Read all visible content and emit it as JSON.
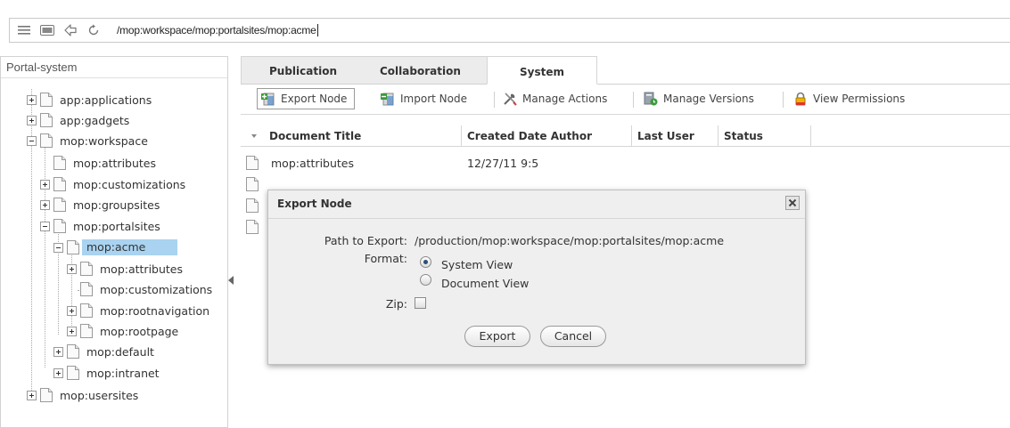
{
  "address_bar": {
    "path": "/mop:workspace/mop:portalsites/mop:acme",
    "icons": [
      "menu-icon",
      "window-icon",
      "back-icon",
      "refresh-icon"
    ]
  },
  "left_panel": {
    "title": "Portal-system",
    "tree": [
      {
        "label": "app:applications",
        "expand": "plus"
      },
      {
        "label": "app:gadgets",
        "expand": "plus"
      },
      {
        "label": "mop:workspace",
        "expand": "minus"
      },
      {
        "label": "mop:attributes",
        "expand": "none"
      },
      {
        "label": "mop:customizations",
        "expand": "plus"
      },
      {
        "label": "mop:groupsites",
        "expand": "plus"
      },
      {
        "label": "mop:portalsites",
        "expand": "minus"
      },
      {
        "label": "mop:acme",
        "expand": "minus",
        "selected": true
      },
      {
        "label": "mop:attributes",
        "expand": "plus"
      },
      {
        "label": "mop:customizations",
        "expand": "none"
      },
      {
        "label": "mop:rootnavigation",
        "expand": "plus"
      },
      {
        "label": "mop:rootpage",
        "expand": "plus"
      },
      {
        "label": "mop:default",
        "expand": "plus"
      },
      {
        "label": "mop:intranet",
        "expand": "plus"
      },
      {
        "label": "mop:usersites",
        "expand": "plus"
      }
    ]
  },
  "tabs": [
    {
      "label": "Publication",
      "active": false
    },
    {
      "label": "Collaboration",
      "active": false
    },
    {
      "label": "System",
      "active": true
    }
  ],
  "toolbar": {
    "export_node": "Export Node",
    "import_node": "Import Node",
    "manage_actions": "Manage Actions",
    "manage_versions": "Manage Versions",
    "view_permissions": "View Permissions"
  },
  "grid": {
    "columns": [
      "Document Title",
      "Created Date",
      "Author",
      "Last User",
      "Status"
    ],
    "rows": [
      {
        "title": "mop:attributes",
        "created": "12/27/11 9:5",
        "author": "",
        "last_user": "",
        "status": ""
      },
      {
        "title": "",
        "created": "",
        "author": "",
        "last_user": "",
        "status": ""
      },
      {
        "title": "",
        "created": "",
        "author": "",
        "last_user": "",
        "status": ""
      },
      {
        "title": "",
        "created": "",
        "author": "",
        "last_user": "",
        "status": ""
      }
    ]
  },
  "dialog": {
    "title": "Export Node",
    "path_label": "Path to Export:",
    "path_value": "/production/mop:workspace/mop:portalsites/mop:acme",
    "format_label": "Format:",
    "format_options": [
      {
        "label": "System View",
        "checked": true
      },
      {
        "label": "Document View",
        "checked": false
      }
    ],
    "zip_label": "Zip:",
    "zip_checked": false,
    "export_button": "Export",
    "cancel_button": "Cancel"
  },
  "colors": {
    "selected_row": "#a9d3f0",
    "dialog_bg": "#efefef",
    "green_accent": "#3a9a3a",
    "tab_bg": "#ececec"
  }
}
